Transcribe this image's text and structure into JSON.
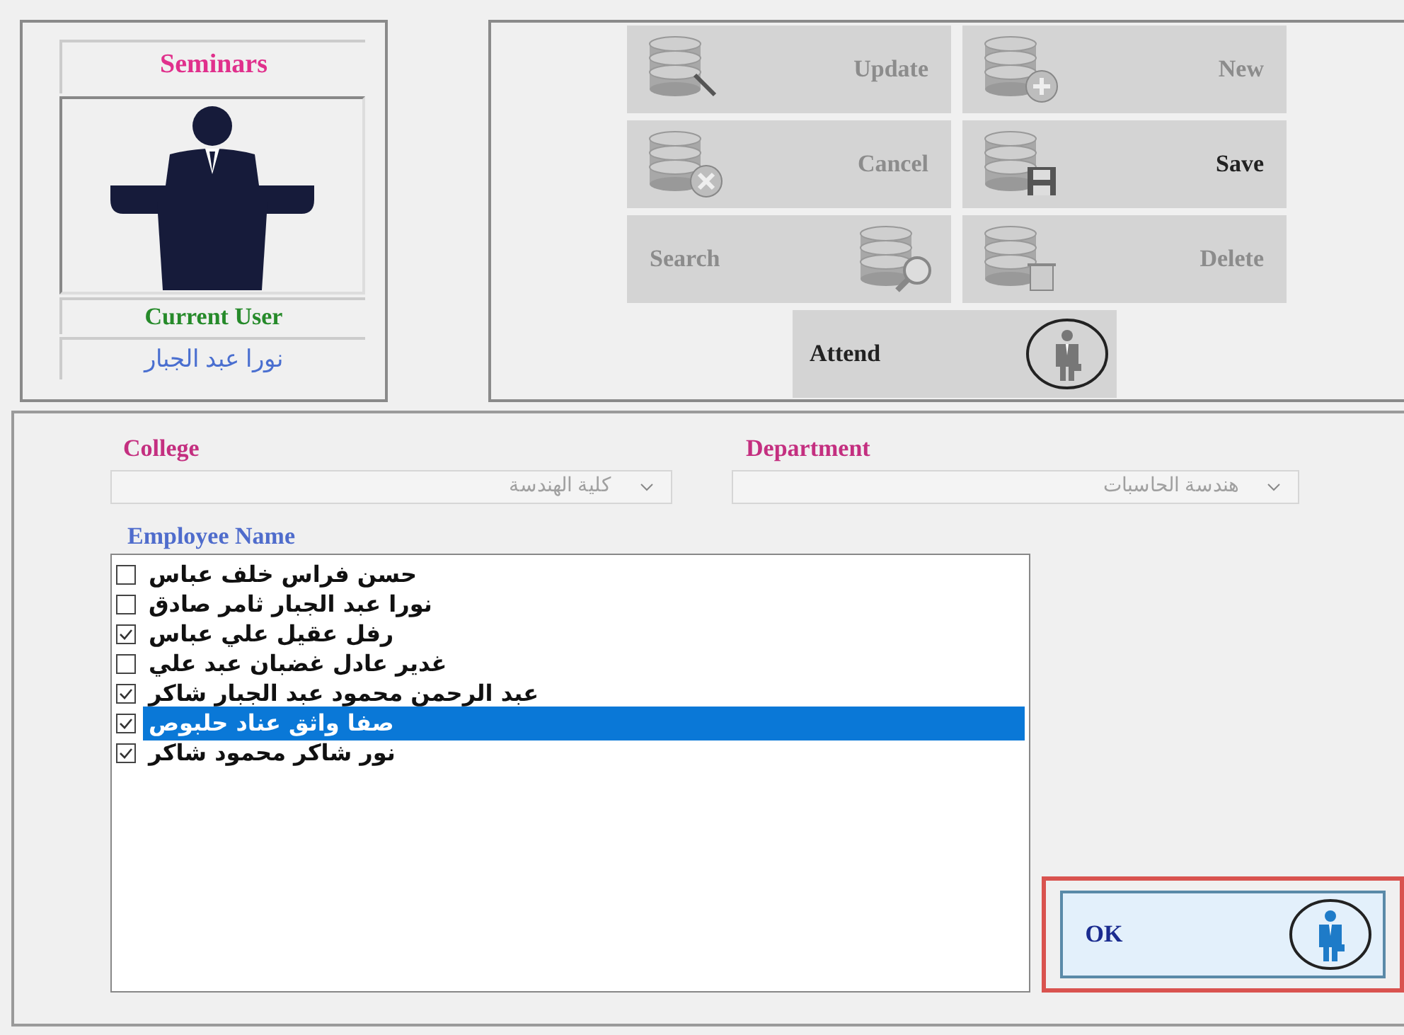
{
  "sidebar": {
    "title": "Seminars",
    "user_label": "Current User",
    "user_name": "نورا عبد الجبار"
  },
  "toolbar": {
    "buttons": [
      {
        "label": "Update",
        "kind": "edit",
        "disabled": true,
        "icon_first": true
      },
      {
        "label": "New",
        "kind": "add",
        "disabled": true,
        "icon_first": true
      },
      {
        "label": "Cancel",
        "kind": "cancel",
        "disabled": true,
        "icon_first": true
      },
      {
        "label": "Save",
        "kind": "save",
        "disabled": false,
        "icon_first": true
      },
      {
        "label": "Search",
        "kind": "search",
        "disabled": true,
        "icon_first": false
      },
      {
        "label": "Delete",
        "kind": "delete",
        "disabled": true,
        "icon_first": true
      }
    ],
    "attend": {
      "label": "Attend",
      "disabled": false
    }
  },
  "form": {
    "college": {
      "label": "College",
      "value": "كلية الهندسة"
    },
    "department": {
      "label": "Department",
      "value": "هندسة الحاسبات"
    },
    "employees": {
      "label": "Employee Name",
      "items": [
        {
          "name": "حسن فراس خلف عباس",
          "checked": false,
          "selected": false
        },
        {
          "name": "نورا عبد الجبار ثامر صادق",
          "checked": false,
          "selected": false
        },
        {
          "name": "رفل عقيل علي عباس",
          "checked": true,
          "selected": false
        },
        {
          "name": "غدير عادل غضبان عبد علي",
          "checked": false,
          "selected": false
        },
        {
          "name": "عبد الرحمن محمود عبد الجبار شاكر",
          "checked": true,
          "selected": false
        },
        {
          "name": "صفا واثق عناد حلبوص",
          "checked": true,
          "selected": true
        },
        {
          "name": "نور شاكر محمود شاكر",
          "checked": true,
          "selected": false
        }
      ]
    },
    "ok": {
      "label": "OK"
    }
  }
}
